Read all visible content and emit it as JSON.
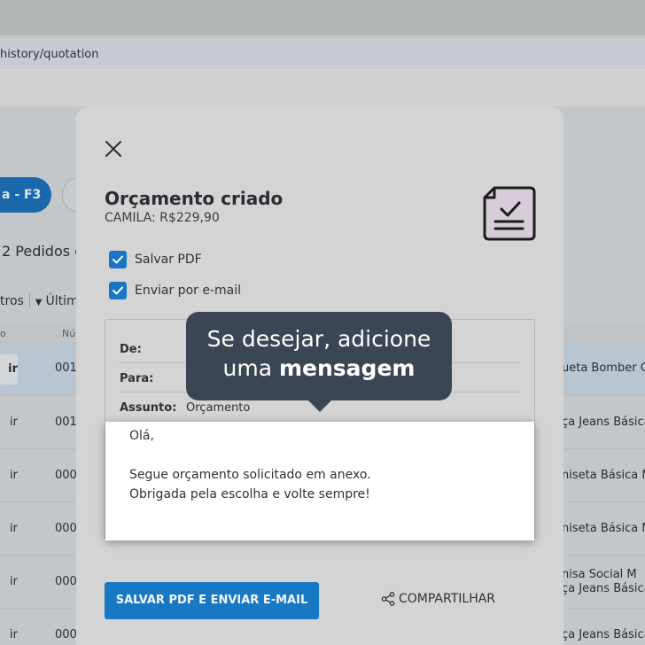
{
  "browser": {
    "url_fragment": "history/quotation"
  },
  "background": {
    "primary_button_fragment": "a - F3",
    "orders_count_text": "2 Pedidos e",
    "filters_label": "tros",
    "sort_label": "Últim",
    "column_1": "o",
    "column_2": "Nú",
    "rows": [
      {
        "action": "ir",
        "number": "001",
        "product": "ueta Bomber G"
      },
      {
        "action": "ir",
        "number": "001",
        "product": "ça Jeans Básica"
      },
      {
        "action": "ir",
        "number": "000",
        "product": "niseta Básica M"
      },
      {
        "action": "ir",
        "number": "000",
        "product": "niseta Básica M"
      },
      {
        "action": "ir",
        "number": "000",
        "product": "nisa Social M",
        "product2": "ça Jeans Básica"
      },
      {
        "action": "ir",
        "number": "000",
        "product": "ça Jeans Básica"
      }
    ]
  },
  "modal": {
    "title": "Orçamento criado",
    "subtitle": "CAMILA: R$229,90",
    "checkbox_pdf": "Salvar PDF",
    "checkbox_email": "Enviar por e-mail",
    "fields": {
      "from_label": "De:",
      "to_label": "Para:",
      "subject_label": "Assunto:",
      "subject_value": "Orçamento"
    },
    "message": {
      "greeting": "Olá,",
      "line1": "Segue orçamento solicitado em anexo.",
      "line2": "Obrigada pela escolha e volte sempre!"
    },
    "primary_button": "SALVAR PDF E ENVIAR E-MAIL",
    "share_button": "COMPARTILHAR"
  },
  "tooltip": {
    "line1": "Se desejar, adicione",
    "line2_prefix": "uma ",
    "line2_bold": "mensagem"
  },
  "colors": {
    "primary": "#1778c4",
    "tooltip_bg": "#3a4653",
    "overlay_modal": "#d4d4d4"
  }
}
